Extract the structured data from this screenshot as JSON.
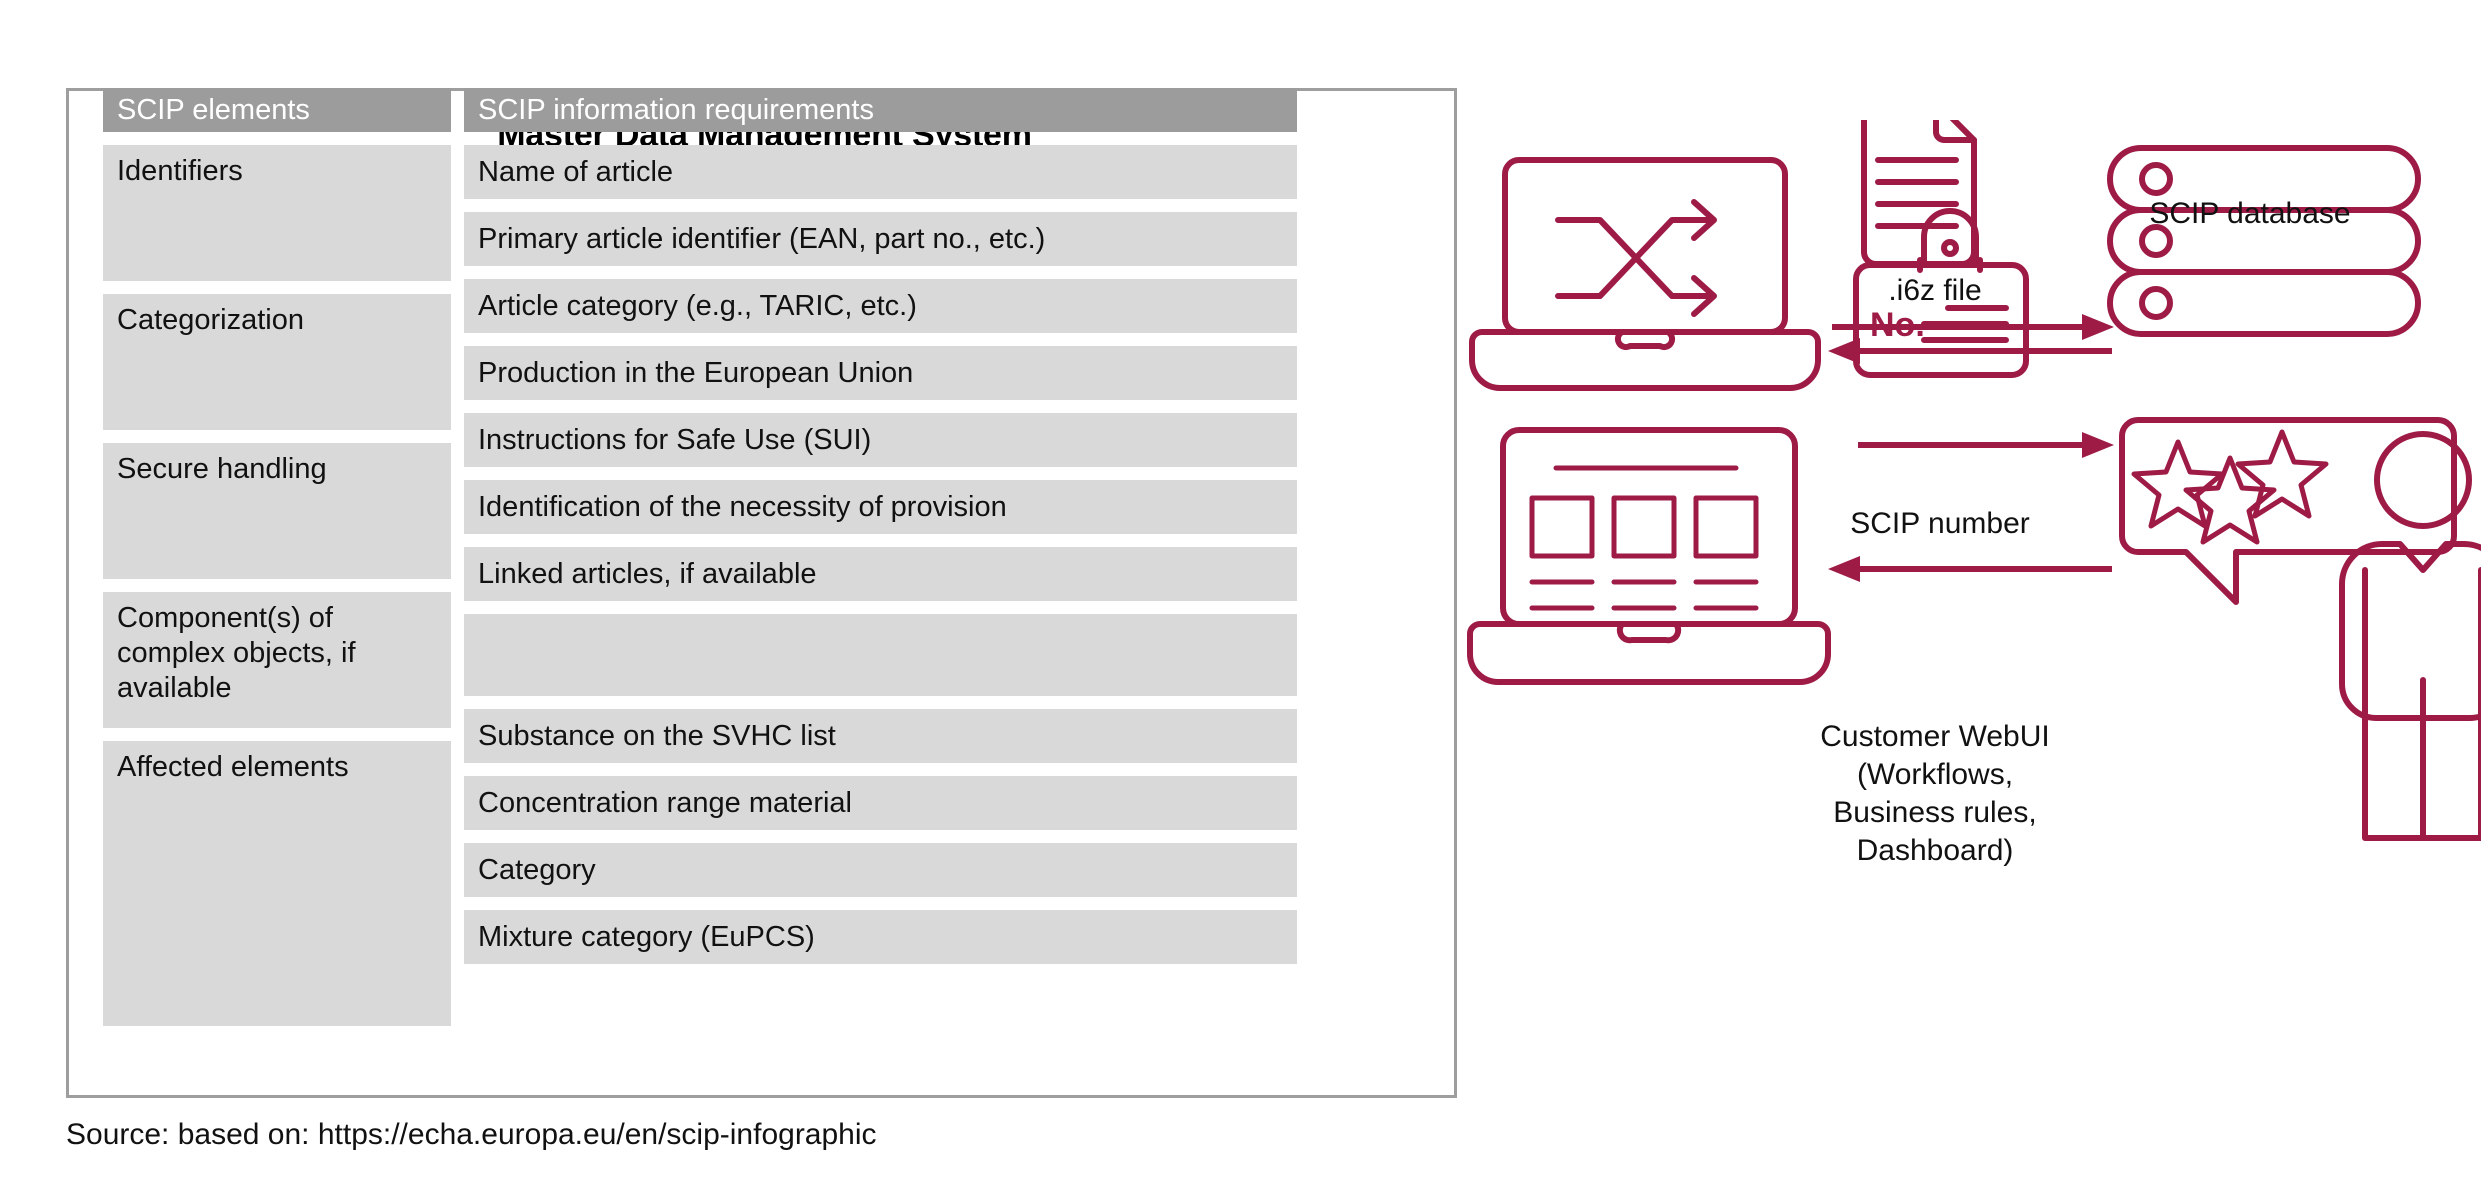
{
  "container": {
    "title": "Master Data Management System"
  },
  "table": {
    "headers": {
      "left": "SCIP elements",
      "right": "SCIP information requirements"
    },
    "groups": [
      {
        "element": "Identifiers",
        "requirements": [
          "Name of article",
          "Primary article identifier (EAN, part no., etc.)"
        ]
      },
      {
        "element": "Categorization",
        "requirements": [
          "Article category (e.g., TARIC, etc.)",
          "Production in the European Union"
        ]
      },
      {
        "element": "Secure handling",
        "requirements": [
          "Instructions for Safe Use (SUI)",
          "Identification of the necessity of provision"
        ]
      },
      {
        "element": "Component(s) of complex objects, if available",
        "requirements": [
          "Linked articles, if available"
        ]
      },
      {
        "element": "Affected elements",
        "requirements": [
          "Substance on the SVHC list",
          "Concentration range material",
          "Category",
          "Mixture category (EuPCS)"
        ]
      }
    ]
  },
  "diagram": {
    "accent_color": "#9e1b45",
    "border_color": "#9e9e9e",
    "file_label": ".i6z file",
    "database_label": "SCIP database",
    "scip_number_label": "SCIP number",
    "badge_text": "No.",
    "customer_flow_label": "Customer WebUI\n(Workflows,\nBusiness rules,\nDashboard)",
    "icons": {
      "laptop_top": "laptop-shuffle-icon",
      "laptop_bottom": "laptop-dashboard-icon",
      "file": "document-file-icon",
      "badge": "id-badge-icon",
      "database": "database-stack-icon",
      "customer": "customer-rating-icon"
    }
  },
  "caption": {
    "source": "Source: based on: https://echa.europa.eu/en/scip-infographic"
  }
}
